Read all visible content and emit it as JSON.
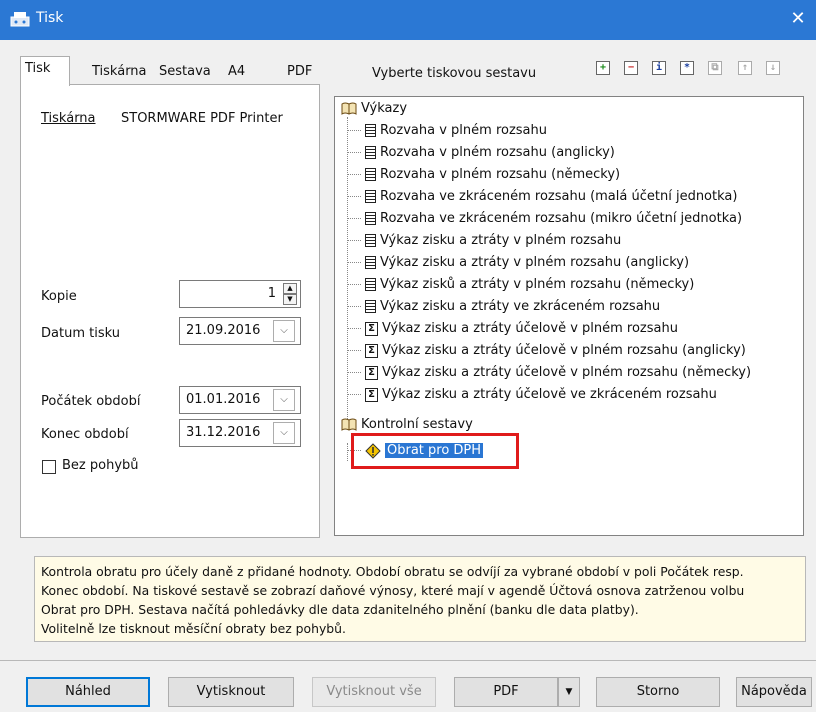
{
  "window": {
    "title": "Tisk",
    "close": "✕"
  },
  "tabs": [
    {
      "label": "Tisk",
      "active": true
    },
    {
      "label": "Tiskárna",
      "active": false
    },
    {
      "label": "Sestava",
      "active": false
    },
    {
      "label": "A4",
      "active": false
    },
    {
      "label": "PDF",
      "active": false
    }
  ],
  "right_header": "Vyberte tiskovou sestavu",
  "toolbar_icons": [
    {
      "name": "expand-icon",
      "glyph": "+"
    },
    {
      "name": "collapse-icon",
      "glyph": "−"
    },
    {
      "name": "info-icon",
      "glyph": "i"
    },
    {
      "name": "favorite-icon",
      "glyph": "*"
    },
    {
      "name": "copy-icon",
      "glyph": "⧉"
    },
    {
      "name": "move-up-icon",
      "glyph": "↑"
    },
    {
      "name": "move-down-icon",
      "glyph": "↓"
    }
  ],
  "left": {
    "printer_link": "Tiskárna",
    "printer_name": "STORMWARE PDF Printer",
    "copies_label": "Kopie",
    "copies_value": "1",
    "print_date_label": "Datum tisku",
    "print_date_value": "21.09.2016",
    "period_start_label": "Počátek období",
    "period_start_value": "01.01.2016",
    "period_end_label": "Konec období",
    "period_end_value": "31.12.2016",
    "no_movements_label": "Bez pohybů"
  },
  "tree": {
    "group1": "Výkazy",
    "items1": [
      {
        "label": "Rozvaha v plném rozsahu",
        "icon": "doc"
      },
      {
        "label": "Rozvaha v plném rozsahu (anglicky)",
        "icon": "doc"
      },
      {
        "label": "Rozvaha v plném rozsahu (německy)",
        "icon": "doc"
      },
      {
        "label": "Rozvaha ve zkráceném rozsahu (malá účetní jednotka)",
        "icon": "doc"
      },
      {
        "label": "Rozvaha ve zkráceném rozsahu (mikro účetní jednotka)",
        "icon": "doc"
      },
      {
        "label": "Výkaz zisku a ztráty v plném rozsahu",
        "icon": "doc"
      },
      {
        "label": "Výkaz zisku a ztráty v plném rozsahu (anglicky)",
        "icon": "doc"
      },
      {
        "label": "Výkaz zisků a ztráty v plném rozsahu (německy)",
        "icon": "doc"
      },
      {
        "label": "Výkaz zisku a ztráty ve zkráceném rozsahu",
        "icon": "doc"
      },
      {
        "label": "Výkaz zisku a ztráty účelově v plném rozsahu",
        "icon": "sigma"
      },
      {
        "label": "Výkaz zisku a ztráty účelově v plném rozsahu (anglicky)",
        "icon": "sigma"
      },
      {
        "label": "Výkaz zisku a ztráty účelově v plném rozsahu (německy)",
        "icon": "sigma"
      },
      {
        "label": "Výkaz zisku a ztráty účelově ve zkráceném rozsahu",
        "icon": "sigma"
      }
    ],
    "group2": "Kontrolní sestavy",
    "items2": [
      {
        "label": "Obrat pro DPH",
        "icon": "warning",
        "selected": true
      }
    ]
  },
  "description": [
    "Kontrola obratu pro účely daně z přidané hodnoty. Období obratu se odvíjí za vybrané období v poli Počátek resp.",
    "Konec období. Na tiskové sestavě se zobrazí daňové výnosy, které mají v agendě Účtová osnova zatrženou volbu",
    "Obrat pro DPH. Sestava načítá pohledávky dle data zdanitelného plnění (banku dle data platby).",
    "Volitelně lze tisknout měsíční obraty bez pohybů."
  ],
  "buttons": {
    "preview": "Náhled",
    "print": "Vytisknout",
    "print_all": "Vytisknout vše",
    "pdf": "PDF",
    "cancel": "Storno",
    "help": "Nápověda"
  },
  "colors": {
    "titlebar": "#2b78d4",
    "selection": "#2a76d3",
    "highlight_box": "#e01b1b",
    "description_bg": "#fffbe6"
  }
}
